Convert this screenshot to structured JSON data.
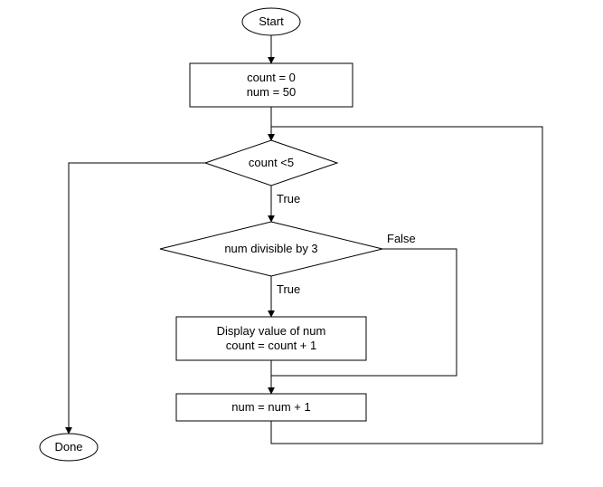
{
  "flowchart": {
    "start": "Start",
    "init": "count = 0\nnum = 50",
    "cond1": "count <5",
    "cond1_true": "True",
    "cond2": "num divisible by 3",
    "cond2_true": "True",
    "cond2_false": "False",
    "display": "Display value of num\ncount = count + 1",
    "increment": "num = num + 1",
    "done": "Done"
  }
}
